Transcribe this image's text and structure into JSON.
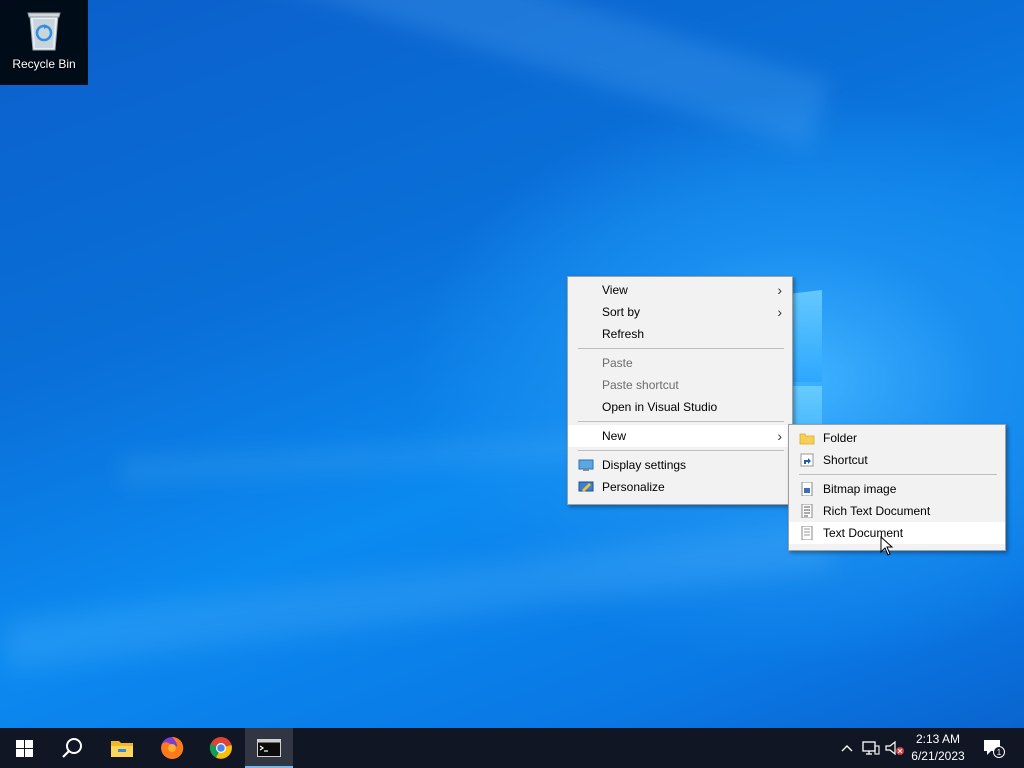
{
  "desktop": {
    "icons": [
      {
        "label": "Recycle Bin",
        "icon": "recycle-bin-icon"
      }
    ]
  },
  "context_menu": {
    "view": "View",
    "sort_by": "Sort by",
    "refresh": "Refresh",
    "paste": "Paste",
    "paste_shortcut": "Paste shortcut",
    "open_visual_studio": "Open in Visual Studio",
    "new": "New",
    "display_settings": "Display settings",
    "personalize": "Personalize"
  },
  "new_submenu": {
    "folder": "Folder",
    "shortcut": "Shortcut",
    "bitmap_image": "Bitmap image",
    "rich_text_document": "Rich Text Document",
    "text_document": "Text Document"
  },
  "taskbar": {
    "apps": [
      "start-icon",
      "search-icon",
      "file-explorer-icon",
      "firefox-icon",
      "chrome-icon",
      "terminal-icon"
    ],
    "tray": {
      "time": "2:13 AM",
      "date": "6/21/2023",
      "notification_count": "1"
    }
  },
  "colors": {
    "taskbar_bg": "#101623",
    "menu_bg": "#f2f2f2",
    "accent": "#76b9ed"
  }
}
